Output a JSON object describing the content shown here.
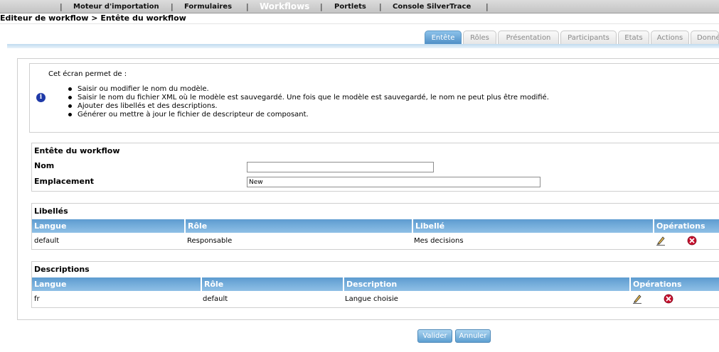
{
  "topnav": {
    "items": [
      "Moteur d'importation",
      "Formulaires",
      "Workflows",
      "Portlets",
      "Console SilverTrace"
    ],
    "active_index": 2,
    "separator": "|"
  },
  "breadcrumb": "Editeur de workflow > Entête du workflow",
  "tabs": [
    "Entête",
    "Rôles",
    "Présentation",
    "Participants",
    "Etats",
    "Actions",
    "Données"
  ],
  "active_tab": 0,
  "info": {
    "title": "Cet écran permet de :",
    "bullets": [
      "Saisir ou modifier le nom du modèle.",
      "Saisir le nom du fichier XML où le modèle est sauvegardé. Une fois que le modèle est sauvegardé, le nom ne peut plus être modifié.",
      "Ajouter des libellés et des descriptions.",
      "Générer ou mettre à jour le fichier de descripteur de composant."
    ]
  },
  "header_section": {
    "title": "Entête du workflow",
    "name_label": "Nom",
    "name_value": "",
    "location_label": "Emplacement",
    "location_value": "New"
  },
  "labels_section": {
    "title": "Libellés",
    "columns": [
      "Langue",
      "Rôle",
      "Libellé",
      "Opérations"
    ],
    "rows": [
      {
        "langue": "default",
        "role": "Responsable",
        "libelle": "Mes decisions"
      }
    ]
  },
  "descriptions_section": {
    "title": "Descriptions",
    "columns": [
      "Langue",
      "Rôle",
      "Description",
      "Opérations"
    ],
    "rows": [
      {
        "langue": "fr",
        "role": "default",
        "description": "Langue choisie"
      }
    ]
  },
  "buttons": {
    "validate": "Valider",
    "cancel": "Annuler"
  },
  "icons": {
    "info": "info-icon",
    "edit": "pencil-icon",
    "delete": "delete-icon"
  },
  "colors": {
    "accent": "#5d9bd0",
    "delete": "#c8102e",
    "info_icon": "#1f3aa8"
  }
}
